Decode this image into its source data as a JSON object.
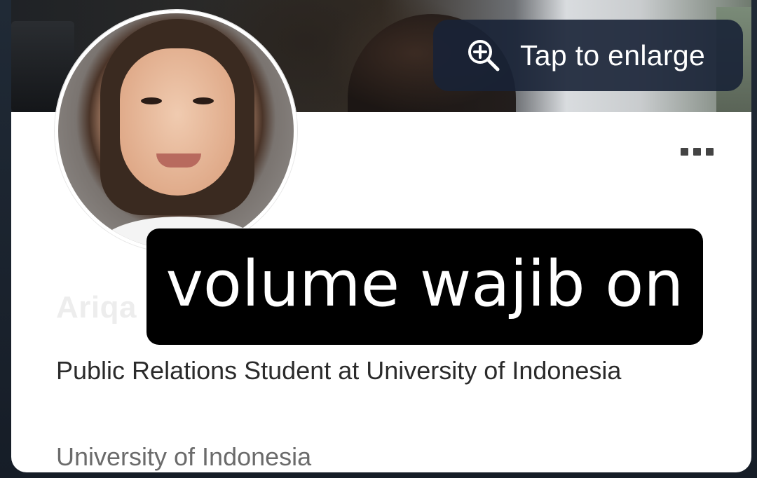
{
  "cover": {
    "enlarge_label": "Tap to enlarge",
    "enlarge_icon": "zoom-in-icon"
  },
  "profile": {
    "name_partial": "Ariqa",
    "headline": "Public Relations Student at University of Indonesia",
    "education": "University of Indonesia",
    "more_icon": "more-options-icon"
  },
  "overlay": {
    "caption": "volume wajib on"
  },
  "colors": {
    "button_bg": "#182236",
    "caption_bg": "#000000",
    "headline_text": "#2b2b2b",
    "secondary_text": "#6b6b6b"
  }
}
